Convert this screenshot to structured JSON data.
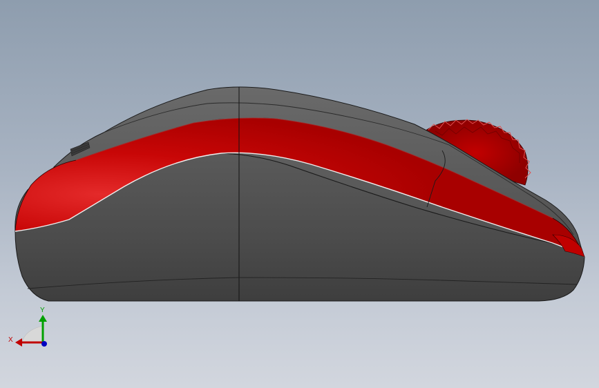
{
  "model": {
    "name": "mouse-side-view",
    "colors": {
      "body_dark": "#4a4a4a",
      "body_mid": "#5a5a5a",
      "body_top": "#555555",
      "accent_red": "#c40000",
      "accent_red_light": "#e01818",
      "wheel_red": "#b80000",
      "edge_line": "#1a1a1a"
    }
  },
  "triad": {
    "x_label": "X",
    "y_label": "Y",
    "x_color": "#c00000",
    "y_color": "#00a000",
    "z_color": "#0000c0"
  }
}
